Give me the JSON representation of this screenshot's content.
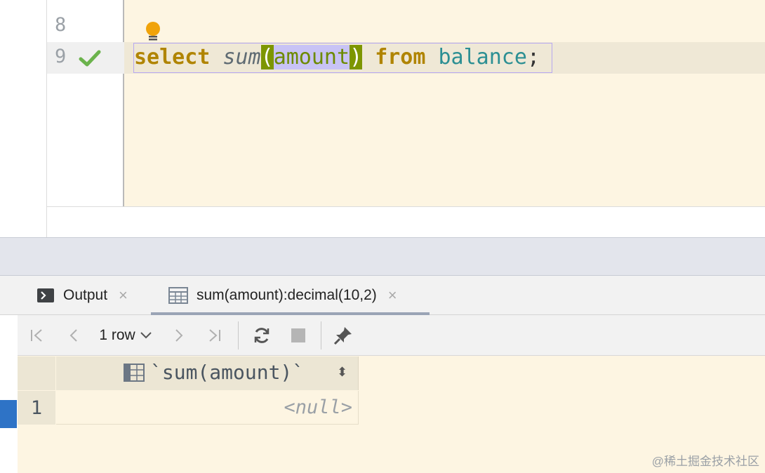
{
  "editor": {
    "line_numbers": [
      "8",
      "9"
    ],
    "code": {
      "kw_select": "select",
      "fn_sum": "sum",
      "paren_open": "(",
      "arg_amount": "amount",
      "paren_close": ")",
      "kw_from": "from",
      "table_name": "balance",
      "semicolon": ";"
    }
  },
  "tabs": [
    {
      "label": "Output",
      "close": "×"
    },
    {
      "label": "sum(amount):decimal(10,2)",
      "close": "×"
    }
  ],
  "toolbar": {
    "row_count": "1 row"
  },
  "grid": {
    "column_header": "`sum(amount)`",
    "sort_glyph": "⬍",
    "rows": [
      {
        "num": "1",
        "value": "<null>"
      }
    ]
  },
  "watermark": "@稀土掘金技术社区",
  "colors": {
    "editor_bg": "#fdf5e2",
    "keyword": "#b08400",
    "identifier": "#2c8f93",
    "bracket_match": "#7d9600",
    "selection": "#c8c3f5",
    "check_green": "#6bb34c",
    "bulb": "#f0a30a"
  }
}
